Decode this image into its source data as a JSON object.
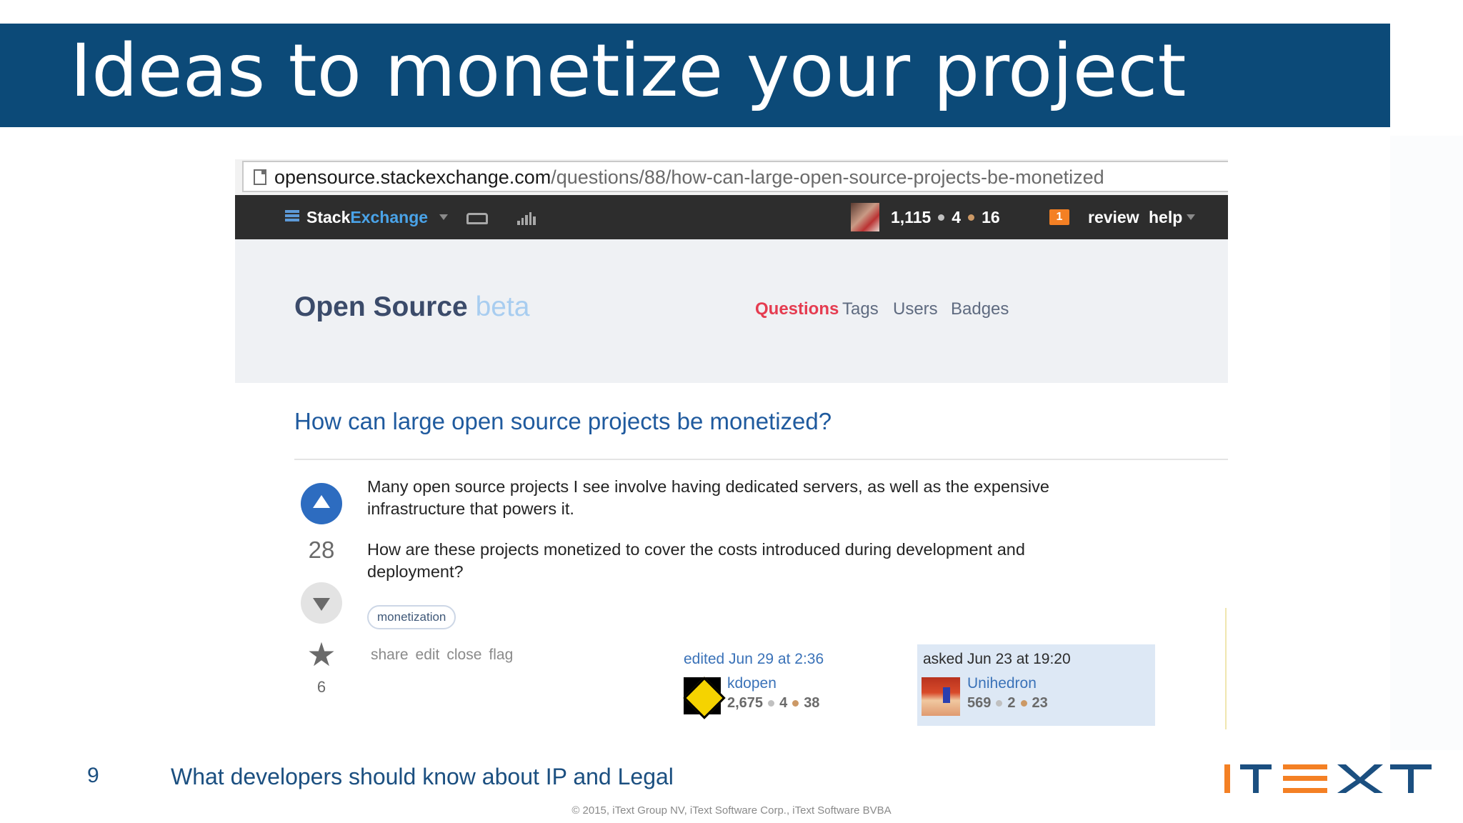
{
  "slide": {
    "title": "Ideas to monetize your project",
    "number": "9",
    "footer_text": "What developers should know about IP and Legal",
    "copyright": "© 2015, iText Group NV, iText Software Corp., iText Software BVBA",
    "logo_alt": "iText logo"
  },
  "browser": {
    "url_domain": "opensource.stackexchange.com",
    "url_path": "/questions/88/how-can-large-open-source-projects-be-monetized"
  },
  "topbar": {
    "brand_stack": "Stack",
    "brand_exchange": "Exchange",
    "reputation": "1,115",
    "silver_badges": "4",
    "bronze_badges": "16",
    "review_count": "1",
    "review_label": "review",
    "help_label": "help"
  },
  "site": {
    "name": "Open Source",
    "beta": "beta",
    "nav": [
      "Questions",
      "Tags",
      "Users",
      "Badges"
    ]
  },
  "question": {
    "title": "How can large open source projects be monetized?",
    "votes": "28",
    "favorites": "6",
    "body": [
      "Many open source projects I see involve having dedicated servers, as well as the expensive infrastructure that powers it.",
      "How are these projects monetized to cover the costs introduced during development and deployment?"
    ],
    "tags": [
      "monetization"
    ],
    "menu": [
      "share",
      "edit",
      "close",
      "flag"
    ],
    "edited": {
      "label": "edited Jun 29 at 2:36",
      "user": "kdopen",
      "rep": "2,675",
      "silver": "4",
      "bronze": "38"
    },
    "asked": {
      "label": "asked Jun 23 at 19:20",
      "user": "Unihedron",
      "rep": "569",
      "silver": "2",
      "bronze": "23"
    }
  },
  "colors": {
    "title_band": "#0c4a78",
    "accent_orange": "#f48024",
    "vote_blue": "#2d6cc0",
    "nav_active": "#e53c50"
  }
}
